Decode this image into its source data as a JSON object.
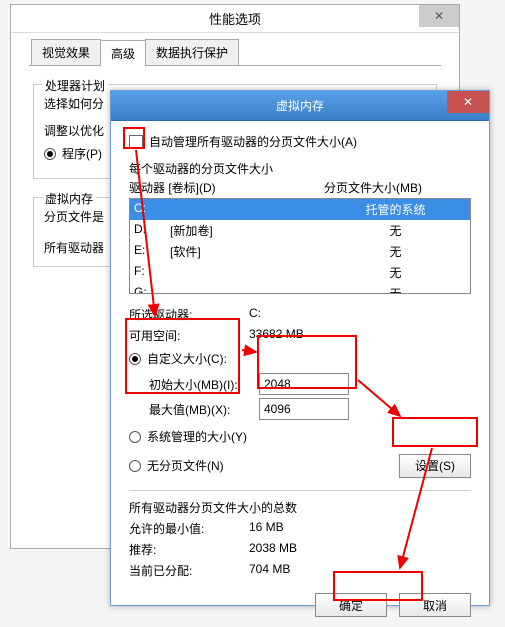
{
  "perf_dialog": {
    "title": "性能选项",
    "close_glyph": "✕",
    "tabs": [
      "视觉效果",
      "高级",
      "数据执行保护"
    ],
    "active_tab_index": 1,
    "proc_section": "处理器计划",
    "proc_line2": "选择如何分",
    "adjust_label": "调整以优化",
    "radio_program": "程序(P)",
    "vm_section": "虚拟内存",
    "vm_line2": "分页文件是",
    "vm_line3": "所有驱动器"
  },
  "vm_dialog": {
    "title": "虚拟内存",
    "close_glyph": "✕",
    "auto_manage": "自动管理所有驱动器的分页文件大小(A)",
    "auto_manage_checked": false,
    "drive_heading": "每个驱动器的分页文件大小",
    "drive_col1": "驱动器 [卷标](D)",
    "drive_col2": "分页文件大小(MB)",
    "drives": [
      {
        "letter": "C:",
        "vol": "",
        "paging": "托管的系统",
        "selected": true
      },
      {
        "letter": "D:",
        "vol": "[新加卷]",
        "paging": "无",
        "selected": false
      },
      {
        "letter": "E:",
        "vol": "[软件]",
        "paging": "无",
        "selected": false
      },
      {
        "letter": "F:",
        "vol": "",
        "paging": "无",
        "selected": false
      },
      {
        "letter": "G:",
        "vol": "",
        "paging": "无",
        "selected": false
      }
    ],
    "selected_drive_label": "所选驱动器:",
    "selected_drive_value": "C:",
    "avail_label": "可用空间:",
    "avail_value": "33682 MB",
    "radio_custom": "自定义大小(C):",
    "initial_label": "初始大小(MB)(I):",
    "initial_value": "2048",
    "max_label": "最大值(MB)(X):",
    "max_value": "4096",
    "radio_system": "系统管理的大小(Y)",
    "radio_none": "无分页文件(N)",
    "set_button": "设置(S)",
    "totals_heading": "所有驱动器分页文件大小的总数",
    "min_label": "允许的最小值:",
    "min_value": "16 MB",
    "rec_label": "推荐:",
    "rec_value": "2038 MB",
    "cur_label": "当前已分配:",
    "cur_value": "704 MB",
    "ok_button": "确定",
    "cancel_button": "取消"
  }
}
